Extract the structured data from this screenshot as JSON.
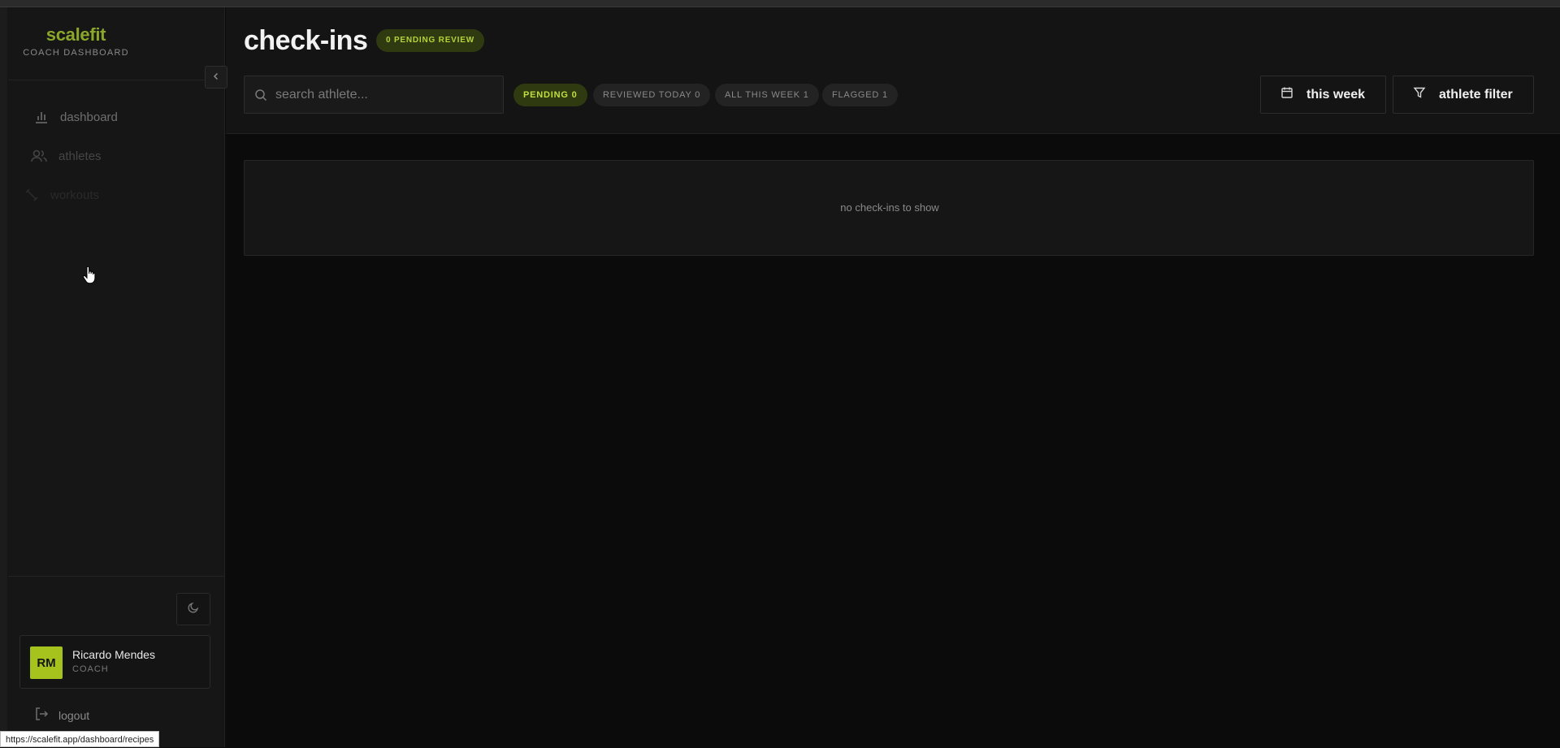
{
  "brand": {
    "name": "scalefit",
    "subtitle": "COACH DASHBOARD"
  },
  "sidebar": {
    "items": [
      {
        "label": "dashboard",
        "icon": "bar-chart-icon"
      },
      {
        "label": "athletes",
        "icon": "users-icon"
      },
      {
        "label": "workouts",
        "icon": "dumbbell-icon"
      }
    ],
    "user": {
      "initials": "RM",
      "name": "Ricardo Mendes",
      "role": "COACH"
    },
    "logout_label": "logout"
  },
  "header": {
    "title": "check-ins",
    "pending_badge": "0 PENDING REVIEW",
    "search_placeholder": "search athlete...",
    "filters": [
      {
        "label": "PENDING 0",
        "active": true
      },
      {
        "label": "REVIEWED TODAY 0",
        "active": false
      },
      {
        "label": "ALL THIS WEEK 1",
        "active": false
      },
      {
        "label": "FLAGGED 1",
        "active": false
      }
    ],
    "date_button": "this week",
    "filter_button": "athlete filter"
  },
  "main": {
    "empty_message": "no check-ins to show"
  },
  "status_url": "https://scalefit.app/dashboard/recipes",
  "colors": {
    "accent": "#a6c21c",
    "brand": "#8aa72a",
    "badge_bg": "#2f3a10",
    "background": "#0b0b0b"
  }
}
